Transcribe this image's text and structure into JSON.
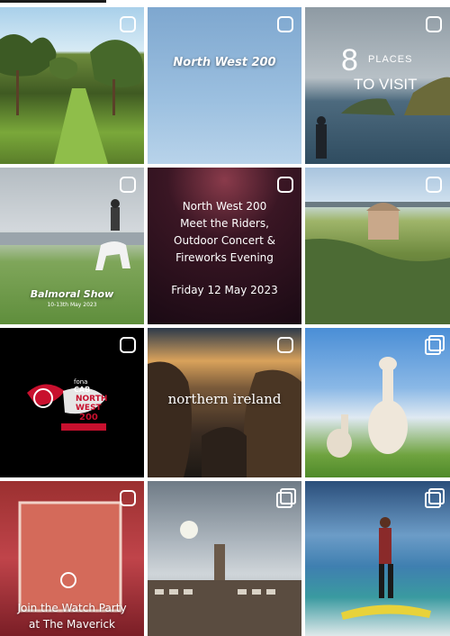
{
  "posts": [
    {
      "id": "orchard",
      "badge": "reel",
      "texts": []
    },
    {
      "id": "nw200-sky",
      "badge": "reel",
      "texts": [
        "North West 200"
      ]
    },
    {
      "id": "places",
      "badge": "reel",
      "texts": [
        "8",
        "PLACES",
        "TO VISIT"
      ]
    },
    {
      "id": "balmoral",
      "badge": "reel",
      "texts": [
        "Balmoral Show",
        "10-13th May 2023"
      ]
    },
    {
      "id": "fireworks",
      "badge": "reel",
      "texts": [
        "North West 200",
        "Meet the Riders,",
        "Outdoor Concert &",
        "Fireworks Evening",
        "Friday 12 May 2023"
      ]
    },
    {
      "id": "temple",
      "badge": "reel",
      "texts": []
    },
    {
      "id": "fonacab",
      "badge": "reel",
      "texts": [
        "fona",
        "CAB",
        "NORTH",
        "WEST",
        "200"
      ]
    },
    {
      "id": "northern-ireland",
      "badge": "reel",
      "texts": [
        "northern ireland"
      ]
    },
    {
      "id": "alpacas",
      "badge": "carousel",
      "texts": []
    },
    {
      "id": "maverick",
      "badge": "reel",
      "texts": [
        "Join the Watch Party",
        "at The Maverick"
      ]
    },
    {
      "id": "tower",
      "badge": "carousel",
      "texts": []
    },
    {
      "id": "surfer",
      "badge": "carousel",
      "texts": []
    }
  ],
  "colors": {
    "badge": "#ffffff",
    "background": "#ffffff"
  }
}
